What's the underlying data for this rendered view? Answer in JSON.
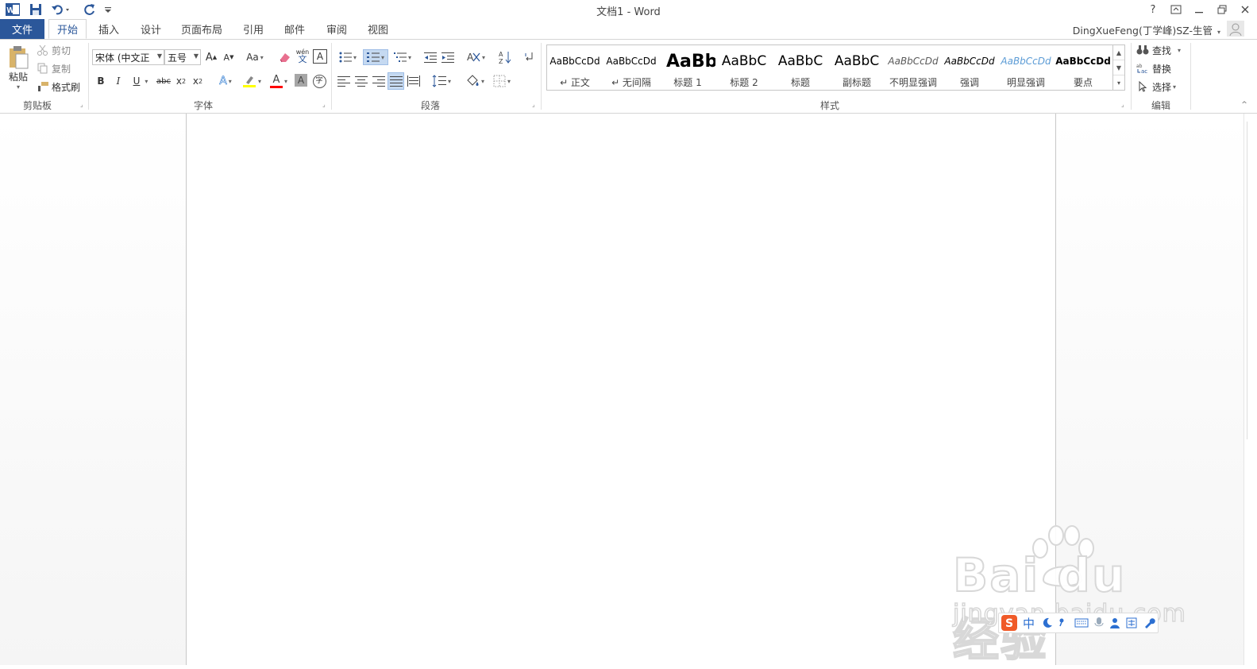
{
  "window": {
    "title": "文档1 - Word",
    "help_glyph": "?",
    "ribbon_display_glyph": "⧉",
    "minimize_glyph": "—",
    "restore_glyph": "❐",
    "close_glyph": "✕"
  },
  "quick_access": {
    "app_icon": "W",
    "save_icon": "save-icon",
    "undo_icon": "undo-icon",
    "redo_icon": "redo-icon",
    "customize_icon": "customize-icon"
  },
  "tabs": [
    {
      "label": "文件"
    },
    {
      "label": "开始"
    },
    {
      "label": "插入"
    },
    {
      "label": "设计"
    },
    {
      "label": "页面布局"
    },
    {
      "label": "引用"
    },
    {
      "label": "邮件"
    },
    {
      "label": "审阅"
    },
    {
      "label": "视图"
    }
  ],
  "user": {
    "name": "DingXueFeng(丁学峰)SZ-生管"
  },
  "clipboard": {
    "label": "剪贴板",
    "paste": "粘贴",
    "cut": "剪切",
    "copy": "复制",
    "format_painter": "格式刷"
  },
  "font": {
    "label": "字体",
    "family": "宋体 (中文正",
    "size": "五号",
    "grow": "A",
    "shrink": "A",
    "change_case": "Aa",
    "phonetic_top": "wén",
    "phonetic_bottom": "文",
    "char_border": "A",
    "bold": "B",
    "italic": "I",
    "underline": "U",
    "strike": "abc",
    "subscript": "x",
    "subscript_mark": "2",
    "superscript": "x",
    "superscript_mark": "2",
    "text_effects": "A",
    "font_color": "A",
    "char_shading": "A",
    "enclose": "字"
  },
  "paragraph": {
    "label": "段落"
  },
  "styles": {
    "label": "样式",
    "items": [
      {
        "preview": "AaBbCcDd",
        "name": "↵ 正文"
      },
      {
        "preview": "AaBbCcDd",
        "name": "↵ 无间隔"
      },
      {
        "preview": "AaBb",
        "name": "标题 1"
      },
      {
        "preview": "AaBbC",
        "name": "标题 2"
      },
      {
        "preview": "AaBbC",
        "name": "标题"
      },
      {
        "preview": "AaBbC",
        "name": "副标题"
      },
      {
        "preview": "AaBbCcDd",
        "name": "不明显强调"
      },
      {
        "preview": "AaBbCcDd",
        "name": "强调"
      },
      {
        "preview": "AaBbCcDd",
        "name": "明显强调"
      },
      {
        "preview": "AaBbCcDd",
        "name": "要点"
      }
    ]
  },
  "editing": {
    "label": "编辑",
    "find": "查找",
    "replace": "替换",
    "select": "选择"
  },
  "watermark": {
    "main": "Bai du 经验",
    "sub": "jingyan.baidu.com"
  },
  "ime": {
    "mode": "中"
  },
  "colors": {
    "accent": "#2b579a",
    "highlight": "#ffff00",
    "font_color_bar": "#ff0000",
    "accent_style": "#5b9bd5"
  }
}
